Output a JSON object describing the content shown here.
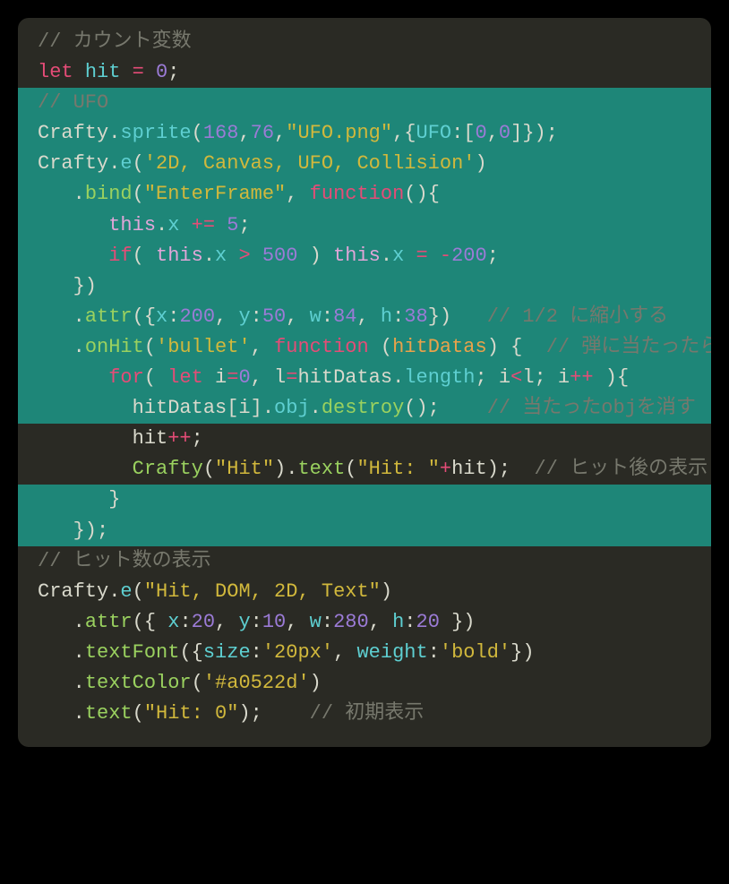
{
  "colors": {
    "bg": "#2a2a24",
    "highlight": "#1e8678",
    "comment": "#77786d",
    "keyword": "#e54c77",
    "ident": "#d9d9cc",
    "prop": "#5ecfd1",
    "method": "#9ad15f",
    "number": "#9b7bd6",
    "string": "#d1b83c",
    "this": "#e0a6d8",
    "param": "#e9a24a"
  },
  "lines": [
    {
      "hl": false,
      "tokens": [
        {
          "t": "// カウント変数",
          "c": "comment"
        }
      ]
    },
    {
      "hl": false,
      "tokens": [
        {
          "t": "let ",
          "c": "keyword"
        },
        {
          "t": "hit ",
          "c": "prop"
        },
        {
          "t": "= ",
          "c": "op"
        },
        {
          "t": "0",
          "c": "number"
        },
        {
          "t": ";",
          "c": "punct"
        }
      ]
    },
    {
      "hl": true,
      "tokens": [
        {
          "t": "// UFO",
          "c": "comment"
        }
      ]
    },
    {
      "hl": true,
      "tokens": [
        {
          "t": "Crafty",
          "c": "ident"
        },
        {
          "t": ".",
          "c": "punct"
        },
        {
          "t": "sprite",
          "c": "prop"
        },
        {
          "t": "(",
          "c": "punct"
        },
        {
          "t": "168",
          "c": "number"
        },
        {
          "t": ",",
          "c": "punct"
        },
        {
          "t": "76",
          "c": "number"
        },
        {
          "t": ",",
          "c": "punct"
        },
        {
          "t": "\"UFO.png\"",
          "c": "string"
        },
        {
          "t": ",{",
          "c": "punct"
        },
        {
          "t": "UFO",
          "c": "prop"
        },
        {
          "t": ":",
          "c": "punct"
        },
        {
          "t": "[",
          "c": "punct"
        },
        {
          "t": "0",
          "c": "number"
        },
        {
          "t": ",",
          "c": "punct"
        },
        {
          "t": "0",
          "c": "number"
        },
        {
          "t": "]",
          "c": "punct"
        },
        {
          "t": "});",
          "c": "punct"
        }
      ]
    },
    {
      "hl": true,
      "tokens": [
        {
          "t": "Crafty",
          "c": "ident"
        },
        {
          "t": ".",
          "c": "punct"
        },
        {
          "t": "e",
          "c": "prop"
        },
        {
          "t": "(",
          "c": "punct"
        },
        {
          "t": "'2D, Canvas, UFO, Collision'",
          "c": "string"
        },
        {
          "t": ")",
          "c": "punct"
        }
      ]
    },
    {
      "hl": true,
      "tokens": [
        {
          "t": "   .",
          "c": "punct"
        },
        {
          "t": "bind",
          "c": "method"
        },
        {
          "t": "(",
          "c": "punct"
        },
        {
          "t": "\"EnterFrame\"",
          "c": "string"
        },
        {
          "t": ", ",
          "c": "punct"
        },
        {
          "t": "function",
          "c": "keyword"
        },
        {
          "t": "(){",
          "c": "punct"
        }
      ]
    },
    {
      "hl": true,
      "tokens": [
        {
          "t": "      ",
          "c": "punct"
        },
        {
          "t": "this",
          "c": "this"
        },
        {
          "t": ".",
          "c": "punct"
        },
        {
          "t": "x ",
          "c": "prop"
        },
        {
          "t": "+= ",
          "c": "op"
        },
        {
          "t": "5",
          "c": "number"
        },
        {
          "t": ";",
          "c": "punct"
        }
      ]
    },
    {
      "hl": true,
      "tokens": [
        {
          "t": "      ",
          "c": "punct"
        },
        {
          "t": "if",
          "c": "keyword"
        },
        {
          "t": "( ",
          "c": "punct"
        },
        {
          "t": "this",
          "c": "this"
        },
        {
          "t": ".",
          "c": "punct"
        },
        {
          "t": "x ",
          "c": "prop"
        },
        {
          "t": "> ",
          "c": "op"
        },
        {
          "t": "500",
          "c": "number"
        },
        {
          "t": " ) ",
          "c": "punct"
        },
        {
          "t": "this",
          "c": "this"
        },
        {
          "t": ".",
          "c": "punct"
        },
        {
          "t": "x ",
          "c": "prop"
        },
        {
          "t": "= ",
          "c": "op"
        },
        {
          "t": "-",
          "c": "op"
        },
        {
          "t": "200",
          "c": "number"
        },
        {
          "t": ";",
          "c": "punct"
        }
      ]
    },
    {
      "hl": true,
      "tokens": [
        {
          "t": "   })",
          "c": "punct"
        }
      ]
    },
    {
      "hl": true,
      "tokens": [
        {
          "t": "   .",
          "c": "punct"
        },
        {
          "t": "attr",
          "c": "method"
        },
        {
          "t": "({",
          "c": "punct"
        },
        {
          "t": "x",
          "c": "prop"
        },
        {
          "t": ":",
          "c": "punct"
        },
        {
          "t": "200",
          "c": "number"
        },
        {
          "t": ", ",
          "c": "punct"
        },
        {
          "t": "y",
          "c": "prop"
        },
        {
          "t": ":",
          "c": "punct"
        },
        {
          "t": "50",
          "c": "number"
        },
        {
          "t": ", ",
          "c": "punct"
        },
        {
          "t": "w",
          "c": "prop"
        },
        {
          "t": ":",
          "c": "punct"
        },
        {
          "t": "84",
          "c": "number"
        },
        {
          "t": ", ",
          "c": "punct"
        },
        {
          "t": "h",
          "c": "prop"
        },
        {
          "t": ":",
          "c": "punct"
        },
        {
          "t": "38",
          "c": "number"
        },
        {
          "t": "})   ",
          "c": "punct"
        },
        {
          "t": "// 1/2 に縮小する",
          "c": "comment"
        }
      ]
    },
    {
      "hl": true,
      "tokens": [
        {
          "t": "   .",
          "c": "punct"
        },
        {
          "t": "onHit",
          "c": "method"
        },
        {
          "t": "(",
          "c": "punct"
        },
        {
          "t": "'bullet'",
          "c": "string"
        },
        {
          "t": ", ",
          "c": "punct"
        },
        {
          "t": "function ",
          "c": "keyword"
        },
        {
          "t": "(",
          "c": "punct"
        },
        {
          "t": "hitDatas",
          "c": "param"
        },
        {
          "t": ") {  ",
          "c": "punct"
        },
        {
          "t": "// 弾に当たったら",
          "c": "comment"
        }
      ]
    },
    {
      "hl": true,
      "tokens": [
        {
          "t": "      ",
          "c": "punct"
        },
        {
          "t": "for",
          "c": "keyword"
        },
        {
          "t": "( ",
          "c": "punct"
        },
        {
          "t": "let ",
          "c": "keyword"
        },
        {
          "t": "i",
          "c": "ident"
        },
        {
          "t": "=",
          "c": "op"
        },
        {
          "t": "0",
          "c": "number"
        },
        {
          "t": ", l",
          "c": "ident"
        },
        {
          "t": "=",
          "c": "op"
        },
        {
          "t": "hitDatas",
          "c": "ident"
        },
        {
          "t": ".",
          "c": "punct"
        },
        {
          "t": "length",
          "c": "prop"
        },
        {
          "t": "; i",
          "c": "ident"
        },
        {
          "t": "<",
          "c": "op"
        },
        {
          "t": "l; i",
          "c": "ident"
        },
        {
          "t": "++ ",
          "c": "op"
        },
        {
          "t": "){",
          "c": "punct"
        }
      ]
    },
    {
      "hl": true,
      "tokens": [
        {
          "t": "        hitDatas[i]",
          "c": "ident"
        },
        {
          "t": ".",
          "c": "punct"
        },
        {
          "t": "obj",
          "c": "prop"
        },
        {
          "t": ".",
          "c": "punct"
        },
        {
          "t": "destroy",
          "c": "method"
        },
        {
          "t": "();    ",
          "c": "punct"
        },
        {
          "t": "// 当たったobjを消す",
          "c": "comment"
        }
      ]
    },
    {
      "hl": false,
      "tokens": [
        {
          "t": "        hit",
          "c": "ident"
        },
        {
          "t": "++",
          "c": "op"
        },
        {
          "t": ";",
          "c": "punct"
        }
      ]
    },
    {
      "hl": false,
      "tokens": [
        {
          "t": "        ",
          "c": "punct"
        },
        {
          "t": "Crafty",
          "c": "method"
        },
        {
          "t": "(",
          "c": "punct"
        },
        {
          "t": "\"Hit\"",
          "c": "string"
        },
        {
          "t": ").",
          "c": "punct"
        },
        {
          "t": "text",
          "c": "method"
        },
        {
          "t": "(",
          "c": "punct"
        },
        {
          "t": "\"Hit: \"",
          "c": "string"
        },
        {
          "t": "+",
          "c": "op"
        },
        {
          "t": "hit);  ",
          "c": "ident"
        },
        {
          "t": "// ヒット後の表示",
          "c": "comment"
        }
      ]
    },
    {
      "hl": true,
      "tokens": [
        {
          "t": "      }",
          "c": "punct"
        }
      ]
    },
    {
      "hl": true,
      "tokens": [
        {
          "t": "   });",
          "c": "punct"
        }
      ]
    },
    {
      "hl": false,
      "tokens": [
        {
          "t": "// ヒット数の表示",
          "c": "comment"
        }
      ]
    },
    {
      "hl": false,
      "tokens": [
        {
          "t": "Crafty",
          "c": "ident"
        },
        {
          "t": ".",
          "c": "punct"
        },
        {
          "t": "e",
          "c": "prop"
        },
        {
          "t": "(",
          "c": "punct"
        },
        {
          "t": "\"Hit, DOM, 2D, Text\"",
          "c": "string"
        },
        {
          "t": ")",
          "c": "punct"
        }
      ]
    },
    {
      "hl": false,
      "tokens": [
        {
          "t": "   .",
          "c": "punct"
        },
        {
          "t": "attr",
          "c": "method"
        },
        {
          "t": "({ ",
          "c": "punct"
        },
        {
          "t": "x",
          "c": "prop"
        },
        {
          "t": ":",
          "c": "punct"
        },
        {
          "t": "20",
          "c": "number"
        },
        {
          "t": ", ",
          "c": "punct"
        },
        {
          "t": "y",
          "c": "prop"
        },
        {
          "t": ":",
          "c": "punct"
        },
        {
          "t": "10",
          "c": "number"
        },
        {
          "t": ", ",
          "c": "punct"
        },
        {
          "t": "w",
          "c": "prop"
        },
        {
          "t": ":",
          "c": "punct"
        },
        {
          "t": "280",
          "c": "number"
        },
        {
          "t": ", ",
          "c": "punct"
        },
        {
          "t": "h",
          "c": "prop"
        },
        {
          "t": ":",
          "c": "punct"
        },
        {
          "t": "20",
          "c": "number"
        },
        {
          "t": " })",
          "c": "punct"
        }
      ]
    },
    {
      "hl": false,
      "tokens": [
        {
          "t": "   .",
          "c": "punct"
        },
        {
          "t": "textFont",
          "c": "method"
        },
        {
          "t": "({",
          "c": "punct"
        },
        {
          "t": "size",
          "c": "prop"
        },
        {
          "t": ":",
          "c": "punct"
        },
        {
          "t": "'20px'",
          "c": "string"
        },
        {
          "t": ", ",
          "c": "punct"
        },
        {
          "t": "weight",
          "c": "prop"
        },
        {
          "t": ":",
          "c": "punct"
        },
        {
          "t": "'bold'",
          "c": "string"
        },
        {
          "t": "})",
          "c": "punct"
        }
      ]
    },
    {
      "hl": false,
      "tokens": [
        {
          "t": "   .",
          "c": "punct"
        },
        {
          "t": "textColor",
          "c": "method"
        },
        {
          "t": "(",
          "c": "punct"
        },
        {
          "t": "'#a0522d'",
          "c": "string"
        },
        {
          "t": ")",
          "c": "punct"
        }
      ]
    },
    {
      "hl": false,
      "tokens": [
        {
          "t": "   .",
          "c": "punct"
        },
        {
          "t": "text",
          "c": "method"
        },
        {
          "t": "(",
          "c": "punct"
        },
        {
          "t": "\"Hit: 0\"",
          "c": "string"
        },
        {
          "t": ");    ",
          "c": "punct"
        },
        {
          "t": "// 初期表示",
          "c": "comment"
        }
      ]
    }
  ]
}
